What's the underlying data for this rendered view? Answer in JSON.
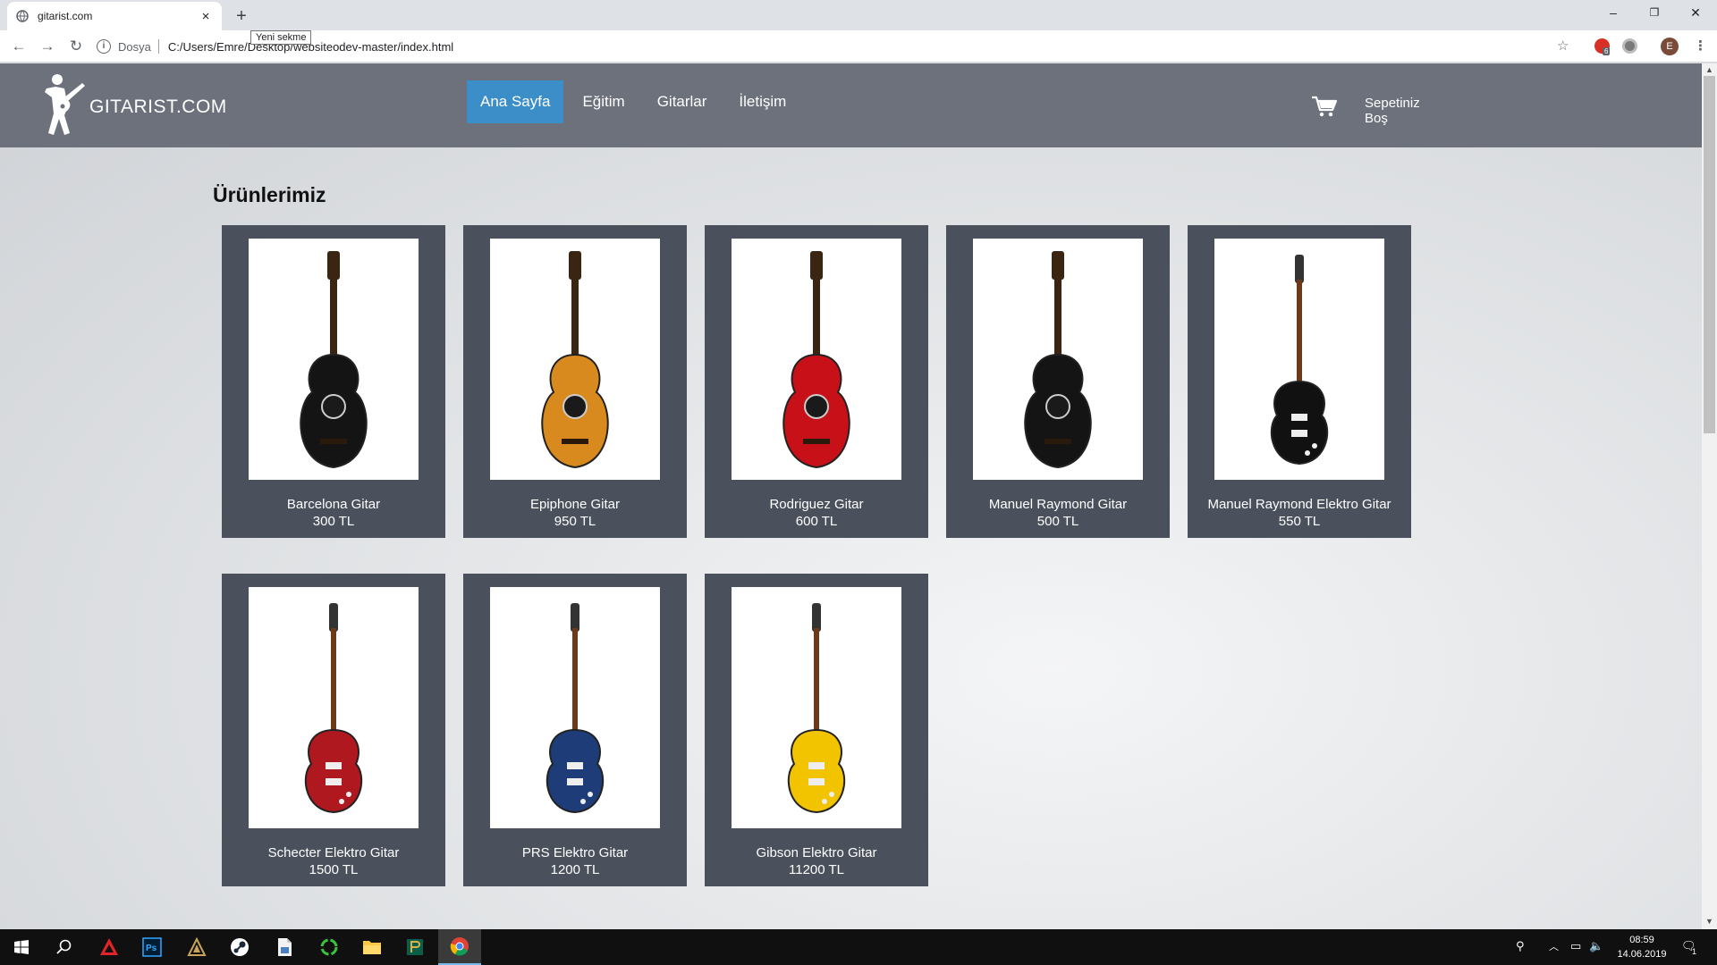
{
  "browser": {
    "tab_title": "gitarist.com",
    "tab_close": "×",
    "new_tab": "+",
    "tooltip": "Yeni sekme",
    "scheme_label": "Dosya",
    "url": "C:/Users/Emre/Desktop/websiteodev-master/index.html",
    "extension_badge": "6",
    "profile_initial": "E",
    "window_controls": [
      "–",
      "❐",
      "✕"
    ]
  },
  "site": {
    "brand": "GITARIST.COM",
    "nav": [
      "Ana Sayfa",
      "Eğitim",
      "Gitarlar",
      "İletişim"
    ],
    "active_nav": "Ana Sayfa",
    "cart_label": "Sepetiniz",
    "cart_status": "Boş",
    "section_title": "Ürünlerimiz"
  },
  "products": [
    {
      "name": "Barcelona Gitar",
      "price": "300 TL",
      "icon": "classical-guitar-black",
      "body_color": "#141414"
    },
    {
      "name": "Epiphone Gitar",
      "price": "950 TL",
      "icon": "classical-guitar-natural",
      "body_color": "#d98a1f"
    },
    {
      "name": "Rodriguez Gitar",
      "price": "600 TL",
      "icon": "classical-guitar-red",
      "body_color": "#c81018"
    },
    {
      "name": "Manuel Raymond Gitar",
      "price": "500 TL",
      "icon": "classical-guitar-black",
      "body_color": "#141414"
    },
    {
      "name": "Manuel Raymond Elektro Gitar",
      "price": "550 TL",
      "icon": "electric-guitar-black",
      "body_color": "#111111"
    },
    {
      "name": "Schecter Elektro Gitar",
      "price": "1500 TL",
      "icon": "electric-guitar-red",
      "body_color": "#b01820"
    },
    {
      "name": "PRS Elektro Gitar",
      "price": "1200 TL",
      "icon": "electric-guitar-blue",
      "body_color": "#1e3c78"
    },
    {
      "name": "Gibson Elektro Gitar",
      "price": "11200 TL",
      "icon": "electric-guitar-yellow",
      "body_color": "#f2c400"
    }
  ],
  "taskbar": {
    "time": "08:59",
    "date": "14.06.2019",
    "notification_count": "1"
  }
}
